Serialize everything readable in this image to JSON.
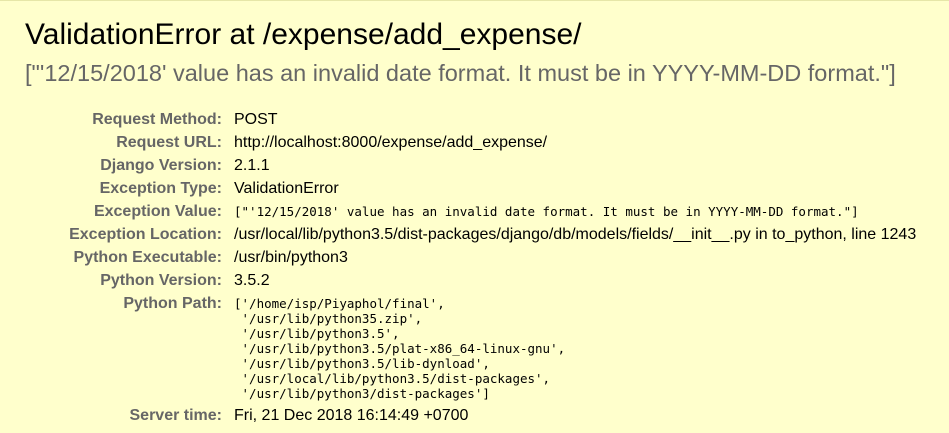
{
  "summary": {
    "title": "ValidationError at /expense/add_expense/",
    "message": "[\"'12/15/2018' value has an invalid date format. It must be in YYYY-MM-DD format.\"]"
  },
  "meta": {
    "request_method": {
      "label": "Request Method:",
      "value": "POST"
    },
    "request_url": {
      "label": "Request URL:",
      "value": "http://localhost:8000/expense/add_expense/"
    },
    "django_version": {
      "label": "Django Version:",
      "value": "2.1.1"
    },
    "exception_type": {
      "label": "Exception Type:",
      "value": "ValidationError"
    },
    "exception_value": {
      "label": "Exception Value:",
      "value": "[\"'12/15/2018' value has an invalid date format. It must be in YYYY-MM-DD format.\"]"
    },
    "exception_location": {
      "label": "Exception Location:",
      "value": "/usr/local/lib/python3.5/dist-packages/django/db/models/fields/__init__.py in to_python, line 1243"
    },
    "python_executable": {
      "label": "Python Executable:",
      "value": "/usr/bin/python3"
    },
    "python_version": {
      "label": "Python Version:",
      "value": "3.5.2"
    },
    "python_path": {
      "label": "Python Path:",
      "value": "['/home/isp/Piyaphol/final',\n '/usr/lib/python35.zip',\n '/usr/lib/python3.5',\n '/usr/lib/python3.5/plat-x86_64-linux-gnu',\n '/usr/lib/python3.5/lib-dynload',\n '/usr/local/lib/python3.5/dist-packages',\n '/usr/lib/python3/dist-packages']"
    },
    "server_time": {
      "label": "Server time:",
      "value": "Fri, 21 Dec 2018 16:14:49 +0700"
    }
  },
  "colors": {
    "background": "#ffffcc",
    "label": "#666666",
    "message": "#666666"
  }
}
